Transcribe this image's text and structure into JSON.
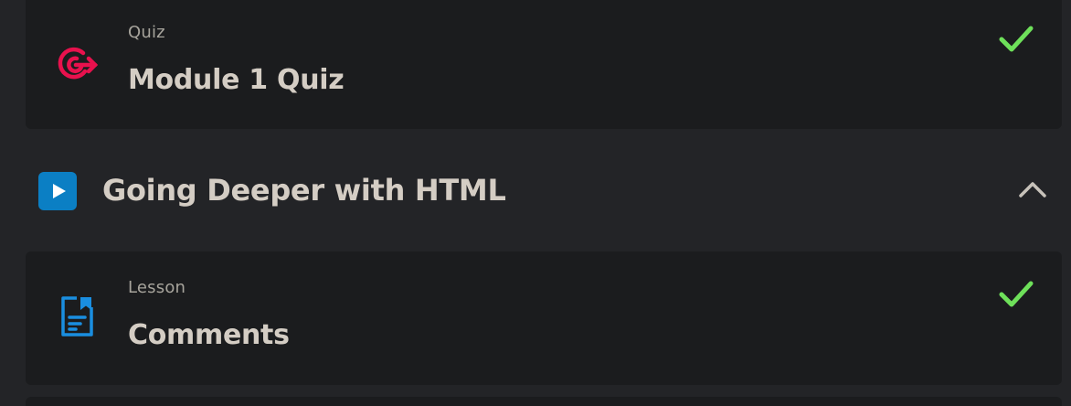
{
  "items": [
    {
      "kind": "Quiz",
      "title": "Module 1 Quiz",
      "icon": "target-icon",
      "icon_color": "#e8114d",
      "completed": true
    },
    {
      "kind": "Lesson",
      "title": "Comments",
      "icon": "document-icon",
      "icon_color": "#1a8ee0",
      "completed": true
    }
  ],
  "section": {
    "title": "Going Deeper with HTML",
    "icon": "play-icon",
    "icon_color": "#0b7fc4",
    "expanded": true,
    "toggle_icon": "chevron-up-icon"
  },
  "colors": {
    "background": "#232427",
    "card": "#1b1c1e",
    "check": "#6ee05a",
    "title_text": "#d4cdc4",
    "kind_text": "#a7a49c"
  }
}
